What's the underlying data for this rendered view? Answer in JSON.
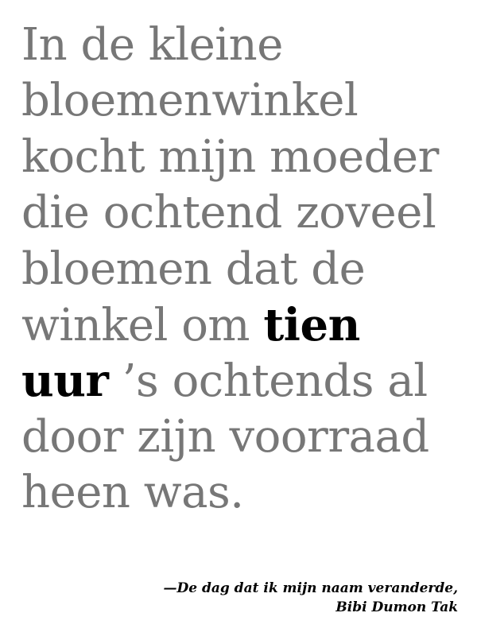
{
  "quote": {
    "lines": [
      "In de kleine",
      "bloemenwinkel",
      "kocht mijn moeder",
      "die ochtend zoveel",
      "bloemen dat de"
    ],
    "line6_prefix": "winkel om ",
    "highlight_part1": "tien",
    "highlight_part2": "uur",
    "line7_suffix": " ’s ochtends al",
    "line8": "door zijn voorraad",
    "line9": "heen was."
  },
  "attribution": {
    "title": "—De dag dat ik mijn naam veranderde,",
    "author": "Bibi Dumon Tak"
  },
  "colors": {
    "body_text": "#777777",
    "highlight_text": "#000000",
    "background": "#ffffff"
  }
}
